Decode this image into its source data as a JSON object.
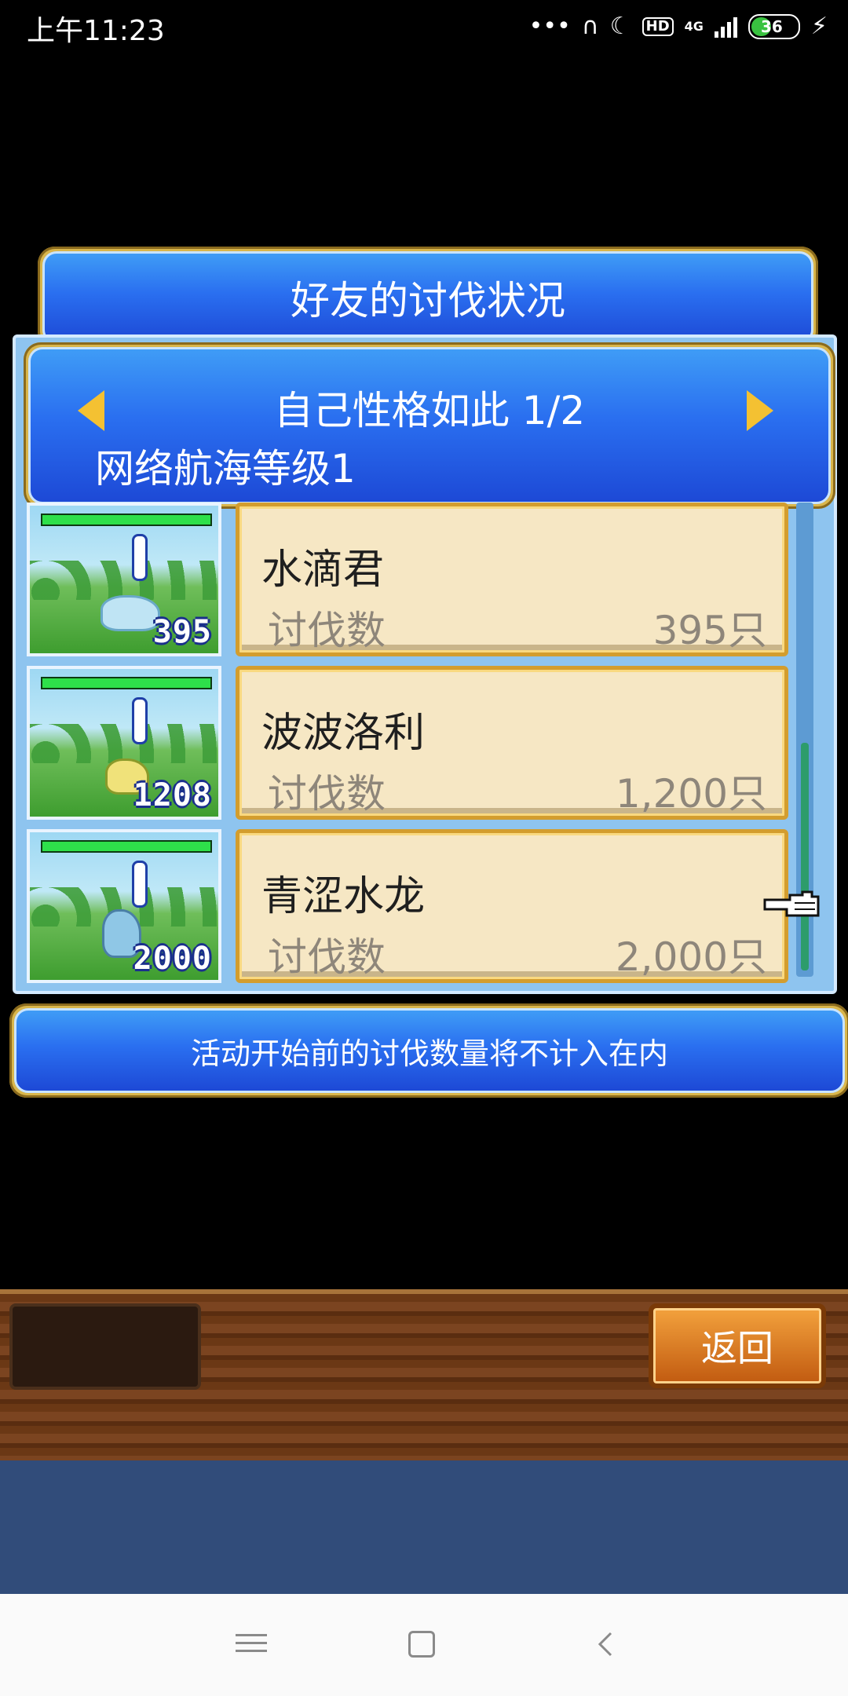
{
  "status_bar": {
    "time": "上午11:23",
    "icons": [
      "more-dots-icon",
      "headphones-icon",
      "moon-icon",
      "hd-icon",
      "4g-signal-icon",
      "battery-icon",
      "charging-icon"
    ],
    "hd": "HD",
    "network": "4G",
    "battery": "36",
    "battery_color": "#39c240"
  },
  "dialog": {
    "title": "好友的讨伐状况",
    "friend_name": "自己性格如此 1/2",
    "friend_level": "网络航海等级1",
    "notice": "活动开始前的讨伐数量将不计入在内"
  },
  "entries": [
    {
      "name": "水滴君",
      "label": "讨伐数",
      "value": "395只",
      "count": "395",
      "icon": "water-drop-monster-icon"
    },
    {
      "name": "波波洛利",
      "label": "讨伐数",
      "value": "1,200只",
      "count": "1208",
      "icon": "pororo-monster-icon"
    },
    {
      "name": "青涩水龙",
      "label": "讨伐数",
      "value": "2,000只",
      "count": "2000",
      "icon": "water-dragon-monster-icon"
    }
  ],
  "footer": {
    "back_label": "返回"
  },
  "colors": {
    "panel_blue": "#2a6ff0",
    "gold_frame": "#d9b64c",
    "card_bg": "#f6e7c4",
    "hp_green": "#2ee04a"
  }
}
